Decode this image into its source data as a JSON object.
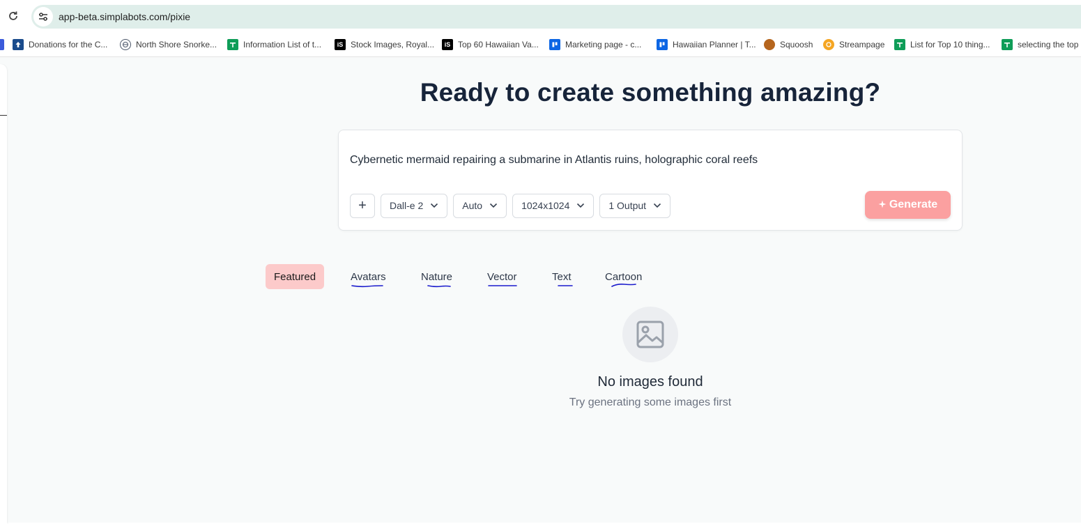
{
  "browser": {
    "url": "app-beta.simplabots.com/pixie",
    "bookmarks": [
      {
        "label": "Donations for the C...",
        "icon": "upload-arrow-icon",
        "color": "#1a4b8c"
      },
      {
        "label": "North Shore Snorke...",
        "icon": "globe-icon",
        "color": "#4a5568"
      },
      {
        "label": "Information List of t...",
        "icon": "sheets-icon",
        "color": "#0f9d58"
      },
      {
        "label": "Stock Images, Royal...",
        "icon": "istock-icon",
        "color": "#000000"
      },
      {
        "label": "Top 60 Hawaiian Va...",
        "icon": "istock-icon",
        "color": "#000000"
      },
      {
        "label": "Marketing page - c...",
        "icon": "trello-icon",
        "color": "#0c66e4"
      },
      {
        "label": "Hawaiian Planner | T...",
        "icon": "trello-icon",
        "color": "#0c66e4"
      },
      {
        "label": "Squoosh",
        "icon": "squoosh-icon",
        "color": "#b5651d"
      },
      {
        "label": "Streampage",
        "icon": "streampage-icon",
        "color": "#f5a623"
      },
      {
        "label": "List for Top 10 thing...",
        "icon": "sheets-icon",
        "color": "#0f9d58"
      },
      {
        "label": "selecting the  top",
        "icon": "sheets-icon",
        "color": "#0f9d58"
      }
    ]
  },
  "main": {
    "title": "Ready to create something amazing?",
    "prompt": "Cybernetic mermaid repairing a submarine in Atlantis ruins, holographic coral reefs",
    "controls": {
      "add_label": "+",
      "model": "Dall-e 2",
      "quality": "Auto",
      "size": "1024x1024",
      "outputs": "1 Output",
      "generate_label": "Generate"
    },
    "tabs": [
      {
        "label": "Featured",
        "active": true
      },
      {
        "label": "Avatars"
      },
      {
        "label": "Nature"
      },
      {
        "label": "Vector"
      },
      {
        "label": "Text"
      },
      {
        "label": "Cartoon"
      }
    ],
    "empty": {
      "icon": "image-icon",
      "title": "No images found",
      "subtitle": "Try generating some images first"
    }
  },
  "colors": {
    "accent": "#fba0a0",
    "active_tab": "#fccaca",
    "annotation": "#1a1acc"
  }
}
